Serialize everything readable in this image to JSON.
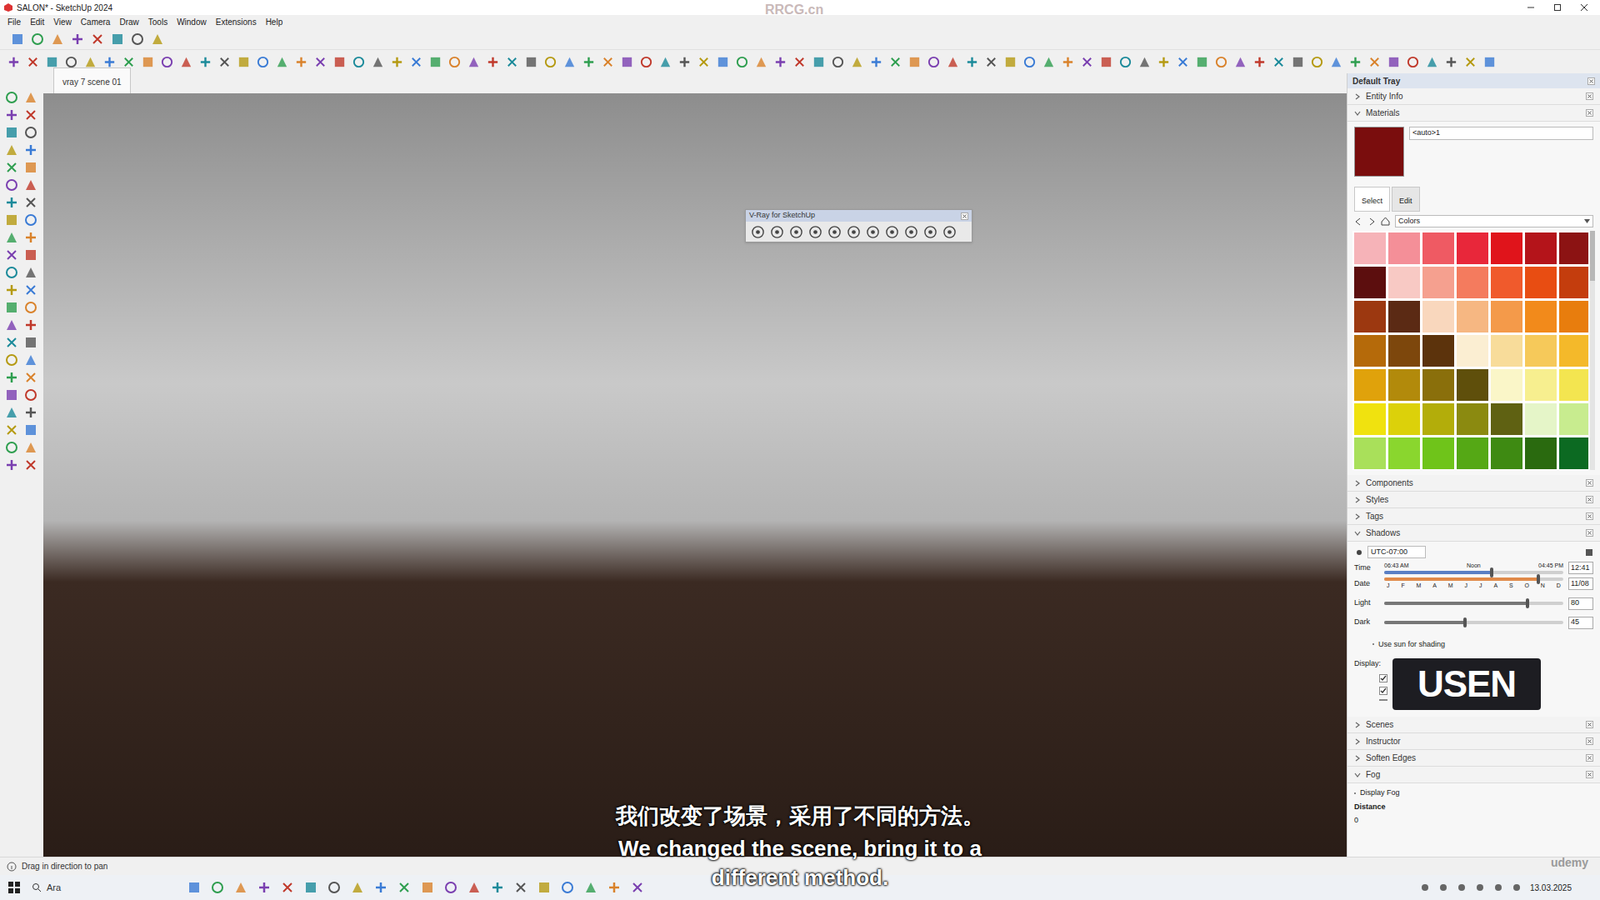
{
  "window": {
    "title": "SALON* - SketchUp 2024",
    "watermark": "RRCG.cn"
  },
  "menu": [
    "File",
    "Edit",
    "View",
    "Camera",
    "Draw",
    "Tools",
    "Window",
    "Extensions",
    "Help"
  ],
  "scene_tabs": [
    {
      "label": "vray 7 scene 01",
      "selected": true
    }
  ],
  "vray_toolbar": {
    "title": "V-Ray for SketchUp"
  },
  "subtitles": {
    "zh": "我们改变了场景，采用了不同的方法。",
    "en": [
      "We changed the scene, bring it to a",
      "different method."
    ]
  },
  "status_bar": "Drag in direction to pan",
  "tray": {
    "title": "Default Tray",
    "entity_info": {
      "label": "Entity Info",
      "expanded": false
    },
    "materials": {
      "label": "Materials",
      "expanded": true,
      "name": "<auto>1",
      "swatch_color": "#7a0d0d",
      "tabs": [
        {
          "label": "Select",
          "selected": true
        },
        {
          "label": "Edit",
          "selected": false
        }
      ],
      "library": "Colors",
      "swatches": [
        "#f6b3b8",
        "#f48f98",
        "#ef5a63",
        "#e8273a",
        "#e0141b",
        "#b4141a",
        "#8c1313",
        "#5c0e0e",
        "#f8c9c4",
        "#f5a08f",
        "#f47b5e",
        "#f05a2c",
        "#e84d12",
        "#c43d0d",
        "#9c3810",
        "#5b2a14",
        "#f9d7bd",
        "#f6b782",
        "#f49a4a",
        "#f28a1b",
        "#e87d0d",
        "#b56a0a",
        "#7d470c",
        "#5c330c",
        "#fbeed2",
        "#f8dc9a",
        "#f6c95a",
        "#f4b92a",
        "#e0a20b",
        "#b28a0b",
        "#8a6f0b",
        "#5f4f0b",
        "#faf6c8",
        "#f7ef8f",
        "#f3e550",
        "#f0e20f",
        "#dcd10a",
        "#b3ad0a",
        "#8b8a10",
        "#5f6112",
        "#e5f5c8",
        "#c8ec8f",
        "#a9e05a",
        "#8ad62e",
        "#6fc41a",
        "#55a815",
        "#3e8a12",
        "#2a6a0f",
        "#0c6a22"
      ]
    },
    "collapsed_a": [
      {
        "label": "Components",
        "expanded": false
      },
      {
        "label": "Styles",
        "expanded": false
      },
      {
        "label": "Tags",
        "expanded": false
      }
    ],
    "shadows": {
      "label": "Shadows",
      "expanded": true,
      "timezone": "UTC-07:00",
      "time_label": "Time",
      "time_start": "06:43 AM",
      "time_mid": "Noon",
      "time_end": "04:45 PM",
      "time_value": "12:41",
      "time_level": 0.6,
      "date_label": "Date",
      "months": [
        "J",
        "F",
        "M",
        "A",
        "M",
        "J",
        "J",
        "A",
        "S",
        "O",
        "N",
        "D"
      ],
      "date_value": "11/08",
      "date_level": 0.86,
      "light_label": "Light",
      "light_value": "80",
      "light_level": 0.8,
      "dark_label": "Dark",
      "dark_value": "45",
      "dark_level": 0.45,
      "use_sun": {
        "label": "Use sun for shading",
        "checked": false
      },
      "display_label": "Display:",
      "display_checks": [
        true,
        true,
        false
      ]
    },
    "collapsed_b": [
      {
        "label": "Scenes",
        "expanded": false
      },
      {
        "label": "Instructor",
        "expanded": false
      },
      {
        "label": "Soften Edges",
        "expanded": false
      }
    ],
    "fog": {
      "label": "Fog",
      "expanded": true,
      "display_fog": {
        "label": "Display Fog",
        "checked": false
      },
      "distance_label": "Distance",
      "distance_value": "0"
    }
  },
  "logo": "USEN",
  "udemy": "udemy",
  "taskbar": {
    "search": "Ara",
    "date": "13.03.2025"
  }
}
